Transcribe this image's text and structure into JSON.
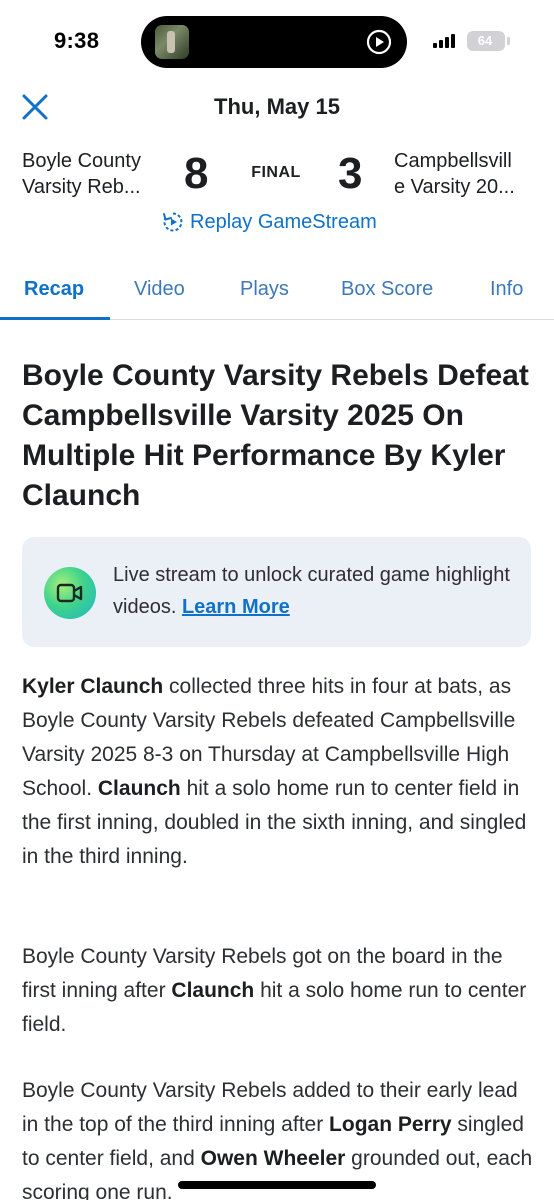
{
  "status_bar": {
    "time": "9:38",
    "battery": "64",
    "icons": [
      "now-playing-thumbnail-icon",
      "play-icon",
      "cellular-signal-icon",
      "battery-icon"
    ]
  },
  "header": {
    "date": "Thu, May 15",
    "home_team": "Boyle County Varsity Reb...",
    "home_team_line1": "Boyle County",
    "home_team_line2": "Varsity Reb...",
    "home_score": "8",
    "status": "FINAL",
    "away_score": "3",
    "away_team_line1": "Campbellsvill",
    "away_team_line2": "e Varsity 20...",
    "replay_label": "Replay GameStream"
  },
  "tabs": [
    {
      "label": "Recap",
      "active": true
    },
    {
      "label": "Video",
      "active": false
    },
    {
      "label": "Plays",
      "active": false
    },
    {
      "label": "Box Score",
      "active": false
    },
    {
      "label": "Info",
      "active": false
    }
  ],
  "article": {
    "headline": "Boyle County Varsity Rebels Defeat Campbellsville Varsity 2025 On Multiple Hit Performance By Kyler Claunch",
    "promo_text": "Live stream to unlock curated game highlight videos.",
    "promo_link": "Learn More",
    "p1_a_bold": "Kyler Claunch",
    "p1_b": " collected three hits in four at bats, as Boyle County Varsity Rebels defeated Campbellsville Varsity 2025 8-3 on Thursday at Campbellsville High School. ",
    "p1_c_bold": "Claunch",
    "p1_d": " hit a solo home run to center field in the first inning, doubled in the sixth inning, and singled in the third inning.",
    "p2_a": "Boyle County Varsity Rebels got on the board in the first inning after ",
    "p2_b_bold": "Claunch",
    "p2_c": " hit a solo home run to center field.",
    "p3_a": "Boyle County Varsity Rebels added to their early lead in the top of the third inning after ",
    "p3_b_bold": "Logan Perry",
    "p3_c": " singled to center field, and ",
    "p3_d_bold": "Owen Wheeler",
    "p3_e": " grounded out, each scoring one run."
  },
  "colors": {
    "accent": "#0f72c8",
    "tab_inactive": "#3d78b8",
    "promo_bg": "#ebf0f6",
    "text": "#1c1e21"
  }
}
